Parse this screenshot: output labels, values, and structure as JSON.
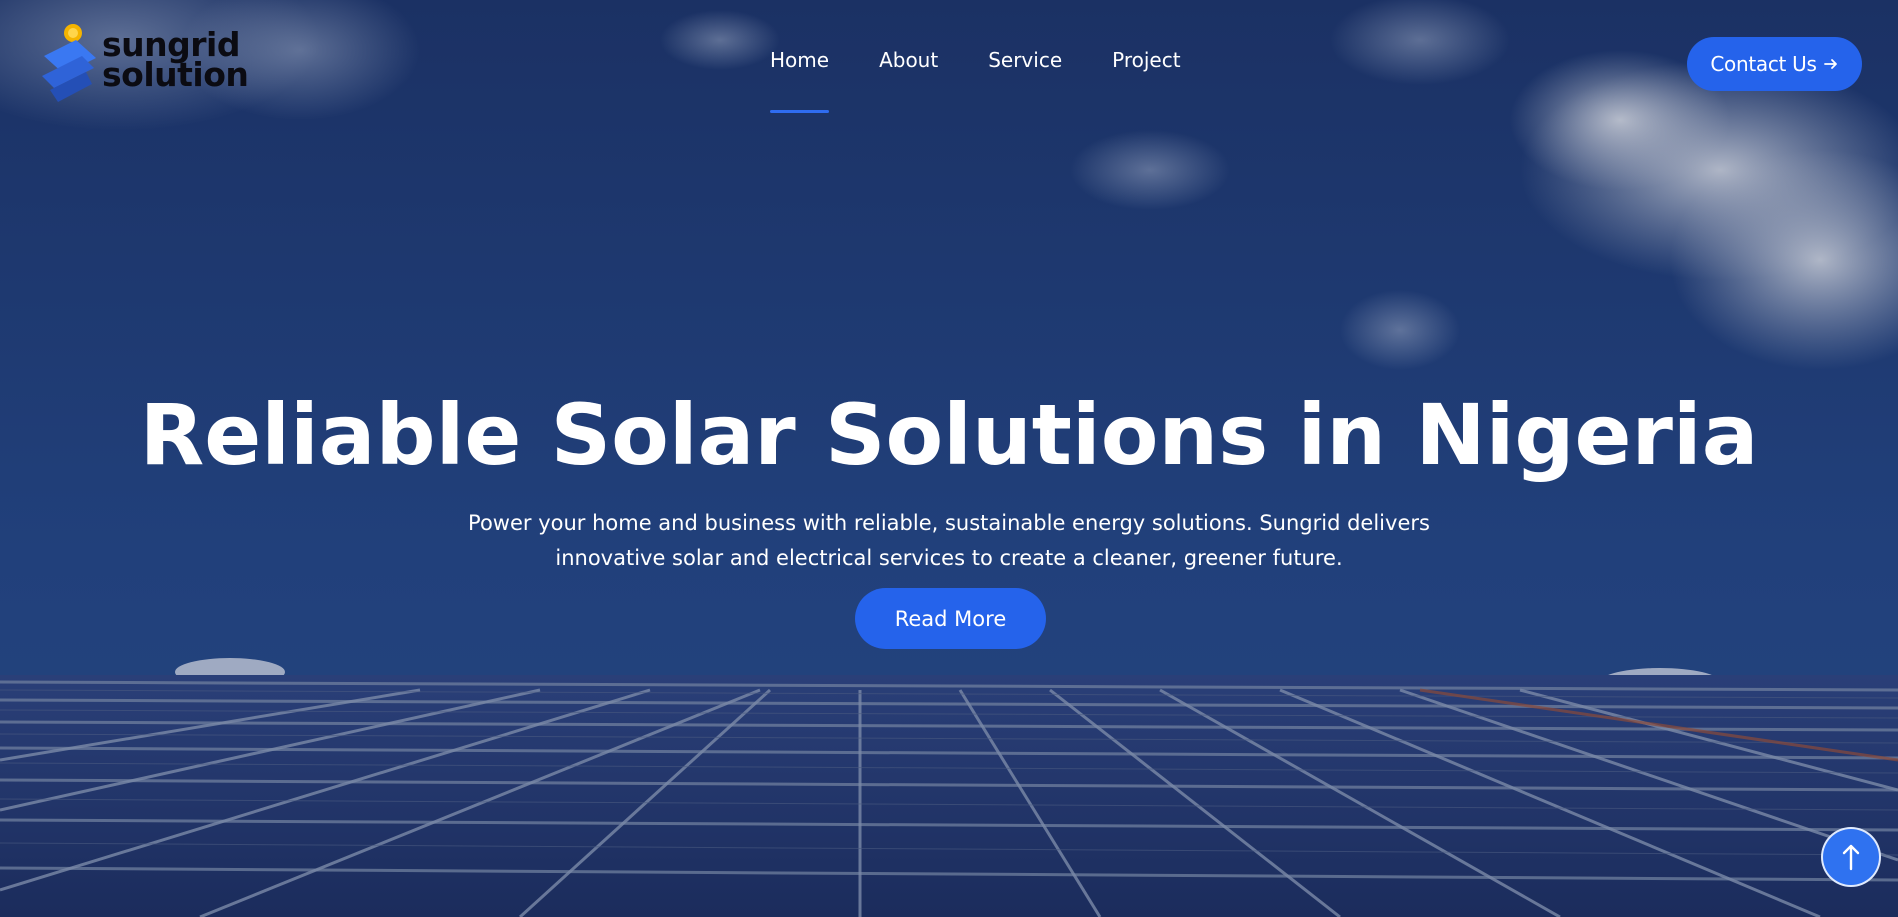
{
  "brand": {
    "line1": "sungrid",
    "line2": "solution",
    "colors": {
      "accent": "#2563eb",
      "logo_blue": "#2f6cf0",
      "sun": "#f5b400"
    }
  },
  "nav": {
    "items": [
      {
        "label": "Home",
        "active": true
      },
      {
        "label": "About",
        "active": false
      },
      {
        "label": "Service",
        "active": false
      },
      {
        "label": "Project",
        "active": false
      }
    ]
  },
  "header": {
    "contact_label": "Contact Us",
    "contact_icon": "arrow-right-icon"
  },
  "hero": {
    "title": "Reliable Solar Solutions in Nigeria",
    "subtitle_line1": "Power your home and business with reliable, sustainable energy solutions. Sungrid delivers",
    "subtitle_line2": "innovative solar and electrical services to create a cleaner, greener future.",
    "cta_label": "Read More"
  },
  "scroll_top": {
    "icon": "arrow-up-icon"
  }
}
